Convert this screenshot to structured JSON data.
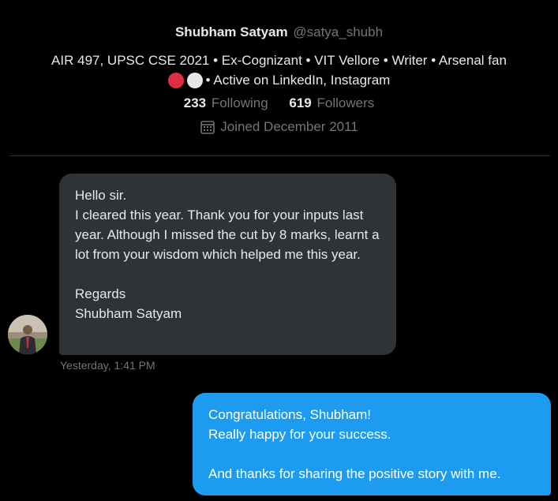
{
  "profile": {
    "display_name": "Shubham Satyam",
    "handle": "@satya_shubh",
    "bio_line1": "AIR 497, UPSC CSE 2021 • Ex-Cognizant • VIT Vellore • Writer • Arsenal fan",
    "bio_emojis": [
      "red-circle",
      "white-circle"
    ],
    "bio_line2": "• Active on LinkedIn, Instagram",
    "following_count": "233",
    "following_label": "Following",
    "followers_count": "619",
    "followers_label": "Followers",
    "joined_icon": "calendar-icon",
    "joined_text": "Joined December 2011"
  },
  "conversation": {
    "messages": [
      {
        "direction": "incoming",
        "text": "Hello sir.\nI cleared this year. Thank you for your inputs last year. Although I missed the cut by 8 marks, learnt a lot from your wisdom which helped me this year.\n\nRegards\nShubham Satyam",
        "timestamp": "Yesterday, 1:41 PM"
      },
      {
        "direction": "outgoing",
        "text": "Congratulations, Shubham!\nReally happy for your success.\n\nAnd thanks for sharing the positive story with me."
      }
    ]
  },
  "colors": {
    "background": "#000000",
    "incoming_bubble": "#2f3336",
    "outgoing_bubble": "#1d9bf0",
    "primary_text": "#e7e9ea",
    "secondary_text": "#71767b",
    "divider": "#2f3336"
  }
}
